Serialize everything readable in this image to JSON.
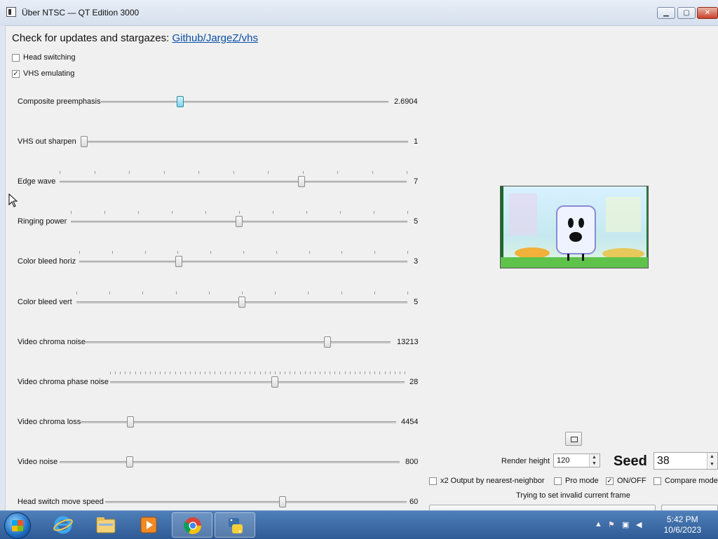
{
  "window": {
    "title": "Über NTSC — QT Edition 3000",
    "buttons": {
      "minimize": "▁",
      "maximize": "▢",
      "close": "✕"
    }
  },
  "header": {
    "updates_text": "Check for updates and stargazes:",
    "updates_link": "Github/JargeZ/vhs"
  },
  "checkboxes": [
    {
      "label": "Head switching",
      "checked": false
    },
    {
      "label": "VHS emulating",
      "checked": true
    }
  ],
  "sliders": [
    {
      "label": "Composite preemphasis",
      "value": "2.6904",
      "fraction": 0.27,
      "focused": true
    },
    {
      "label": "VHS out sharpen",
      "value": "1",
      "fraction": 0.0
    },
    {
      "label": "Edge wave",
      "value": "7",
      "fraction": 0.7,
      "ticked": true
    },
    {
      "label": "Ringing power",
      "value": "5",
      "fraction": 0.5,
      "ticked": true
    },
    {
      "label": "Color bleed horiz",
      "value": "3",
      "fraction": 0.3,
      "ticked": true
    },
    {
      "label": "Color bleed vert",
      "value": "5",
      "fraction": 0.5,
      "ticked": true
    },
    {
      "label": "Video chroma noise",
      "value": "13213",
      "fraction": 0.8
    },
    {
      "label": "Video chroma phase noise",
      "value": "28",
      "fraction": 0.56,
      "ticked": true,
      "dense": true
    },
    {
      "label": "Video chroma loss",
      "value": "4454",
      "fraction": 0.15
    },
    {
      "label": "Video noise",
      "value": "800",
      "fraction": 0.2
    },
    {
      "label": "Head switch move speed",
      "value": "60",
      "fraction": 0.59
    }
  ],
  "controls": {
    "render_height_label": "Render height",
    "render_height_value": "120",
    "seed_label": "Seed",
    "seed_value": "38",
    "x2_label": "x2 Output by nearest-neighbor",
    "pro_label": "Pro mode",
    "onoff_label": "ON/OFF",
    "compare_label": "Compare mode",
    "status": "Trying to set invalid current frame"
  },
  "taskbar": {
    "apps": [
      "start-orb",
      "internet-explorer",
      "windows-explorer",
      "media-player",
      "chrome",
      "python"
    ],
    "clock_time": "5:42 PM",
    "clock_date": "10/6/2023"
  }
}
